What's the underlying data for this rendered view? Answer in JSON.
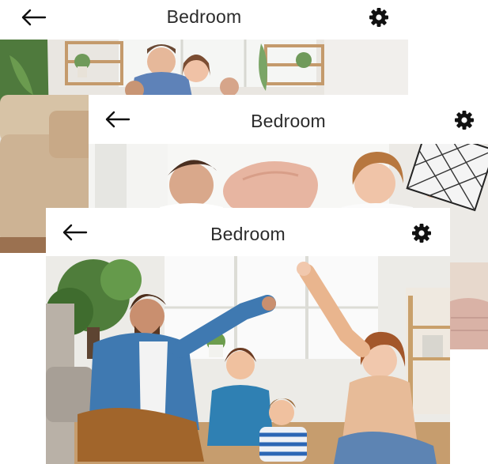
{
  "screens": [
    {
      "title": "Bedroom",
      "back_icon": "arrow-left-icon",
      "settings_icon": "gear-icon",
      "photo": "family-in-living-room"
    },
    {
      "title": "Bedroom",
      "back_icon": "arrow-left-icon",
      "settings_icon": "gear-icon",
      "photo": "couple-pillow-fight"
    },
    {
      "title": "Bedroom",
      "back_icon": "arrow-left-icon",
      "settings_icon": "gear-icon",
      "photo": "family-sitting-on-floor"
    }
  ],
  "colors": {
    "text": "#2b2b2b",
    "icon": "#111111",
    "header_bg": "#ffffff"
  }
}
